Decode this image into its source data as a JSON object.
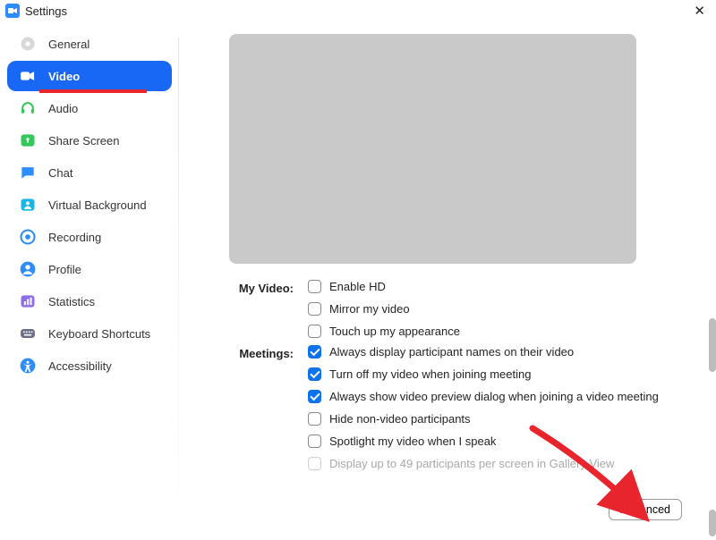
{
  "window": {
    "title": "Settings"
  },
  "sidebar": {
    "items": [
      {
        "id": "general",
        "label": "General"
      },
      {
        "id": "video",
        "label": "Video"
      },
      {
        "id": "audio",
        "label": "Audio"
      },
      {
        "id": "share",
        "label": "Share Screen"
      },
      {
        "id": "chat",
        "label": "Chat"
      },
      {
        "id": "vbg",
        "label": "Virtual Background"
      },
      {
        "id": "recording",
        "label": "Recording"
      },
      {
        "id": "profile",
        "label": "Profile"
      },
      {
        "id": "stats",
        "label": "Statistics"
      },
      {
        "id": "keyboard",
        "label": "Keyboard Shortcuts"
      },
      {
        "id": "accessibility",
        "label": "Accessibility"
      }
    ],
    "active_index": 1
  },
  "content": {
    "sections": {
      "my_video": {
        "label": "My Video:",
        "options": [
          {
            "label": "Enable HD",
            "checked": false
          },
          {
            "label": "Mirror my video",
            "checked": false
          },
          {
            "label": "Touch up my appearance",
            "checked": false
          }
        ]
      },
      "meetings": {
        "label": "Meetings:",
        "options": [
          {
            "label": "Always display participant names on their video",
            "checked": true
          },
          {
            "label": "Turn off my video when joining meeting",
            "checked": true
          },
          {
            "label": "Always show video preview dialog when joining a video meeting",
            "checked": true
          },
          {
            "label": "Hide non-video participants",
            "checked": false
          },
          {
            "label": "Spotlight my video when I speak",
            "checked": false
          },
          {
            "label": "Display up to 49 participants per screen in Gallery View",
            "checked": false,
            "disabled": true
          }
        ]
      }
    },
    "advanced_label": "Advanced"
  },
  "colors": {
    "accent": "#0E72ED",
    "sidebar_active": "#1867F5",
    "annotation": "#E8252D"
  }
}
